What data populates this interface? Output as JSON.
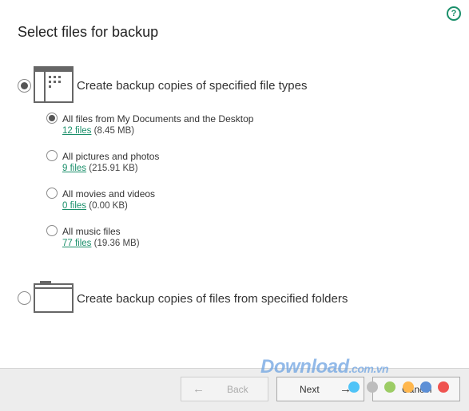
{
  "header": {
    "title": "Select files for backup",
    "help_glyph": "?"
  },
  "option_types": {
    "label": "Create backup copies of specified file types",
    "selected": true,
    "icon": "window-grid-icon",
    "sub_options": [
      {
        "label": "All files from My Documents and the Desktop",
        "files_link": "12 files",
        "size": "(8.45 MB)",
        "selected": true
      },
      {
        "label": "All pictures and photos",
        "files_link": "9 files",
        "size": "(215.91 KB)",
        "selected": false
      },
      {
        "label": "All movies and videos",
        "files_link": "0 files",
        "size": "(0.00 KB)",
        "selected": false
      },
      {
        "label": "All music files",
        "files_link": "77 files",
        "size": "(19.36 MB)",
        "selected": false
      }
    ]
  },
  "option_folders": {
    "label": "Create backup copies of files from specified folders",
    "selected": false,
    "icon": "folder-icon"
  },
  "footer": {
    "back_label": "Back",
    "back_arrow": "←",
    "next_label": "Next",
    "next_arrow": "→",
    "cancel_label": "Cancel"
  },
  "watermark": {
    "text": "Download",
    "tld": ".com.vn",
    "dot_colors": [
      "#4fc3f7",
      "#bdbdbd",
      "#9ccc65",
      "#ffb74d",
      "#5c8fd6",
      "#ef5350"
    ]
  },
  "colors": {
    "accent": "#1a8f6a",
    "footer_bg": "#ededed"
  }
}
